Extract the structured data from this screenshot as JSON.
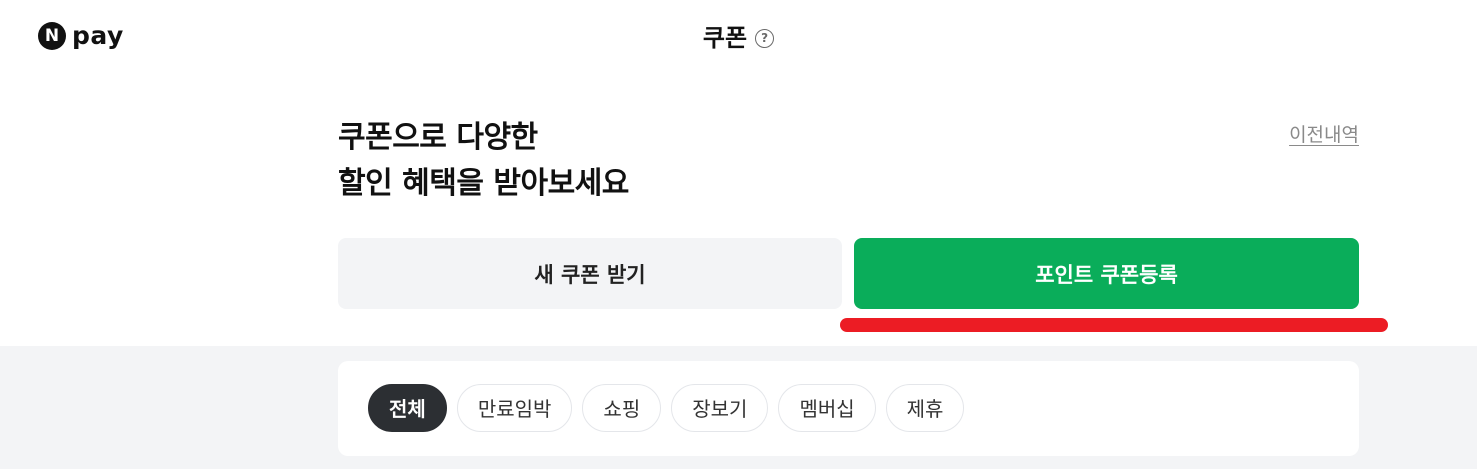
{
  "header": {
    "logo_badge": "N",
    "logo_text": "pay",
    "title": "쿠폰",
    "help_icon": "help-circle-icon"
  },
  "hero": {
    "headline_line1": "쿠폰으로 다양한",
    "headline_line2": "할인 혜택을 받아보세요",
    "history_link": "이전내역"
  },
  "actions": {
    "new_coupon_label": "새 쿠폰 받기",
    "register_coupon_label": "포인트 쿠폰등록"
  },
  "filters": {
    "active_index": 0,
    "chips": [
      {
        "label": "전체"
      },
      {
        "label": "만료임박"
      },
      {
        "label": "쇼핑"
      },
      {
        "label": "장보기"
      },
      {
        "label": "멤버십"
      },
      {
        "label": "제휴"
      }
    ]
  },
  "colors": {
    "brand_green": "#0aad5a",
    "highlight_red": "#ec1c24",
    "active_chip": "#2c2f33",
    "background_gray": "#f3f4f6"
  }
}
